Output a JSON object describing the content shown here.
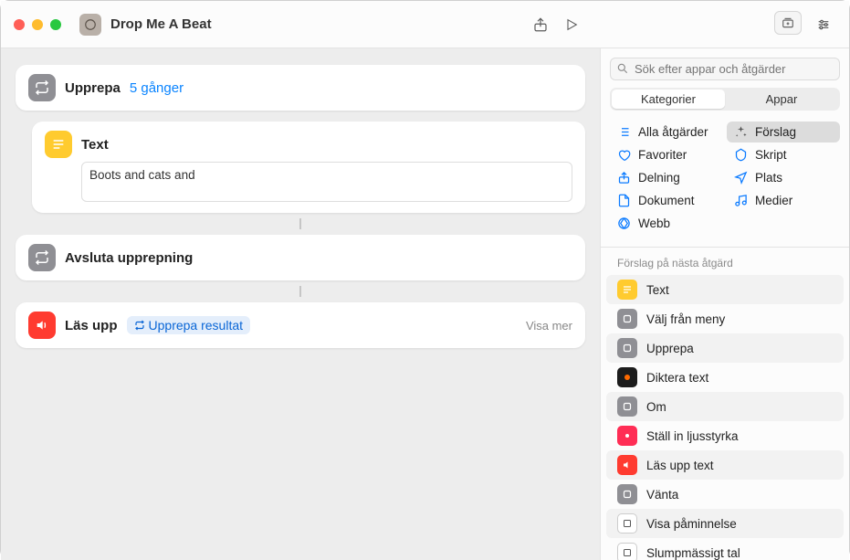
{
  "window": {
    "title": "Drop Me A Beat"
  },
  "canvas": {
    "repeat": {
      "title": "Upprepa",
      "count": "5 gånger"
    },
    "text": {
      "title": "Text",
      "content": "Boots and cats and "
    },
    "endRepeat": {
      "title": "Avsluta upprepning"
    },
    "speak": {
      "title": "Läs upp",
      "varToken": "Upprepa resultat",
      "showMore": "Visa mer"
    }
  },
  "sidebar": {
    "search": {
      "placeholder": "Sök efter appar och åtgärder"
    },
    "seg": {
      "left": "Kategorier",
      "right": "Appar"
    },
    "cats": {
      "all": "Alla åtgärder",
      "suggestions": "Förslag",
      "favorites": "Favoriter",
      "scripting": "Skript",
      "sharing": "Delning",
      "location": "Plats",
      "documents": "Dokument",
      "media": "Medier",
      "web": "Webb"
    },
    "sectionHeader": "Förslag på nästa åtgärd",
    "suggestions": [
      {
        "label": "Text",
        "color": "ic-yellow"
      },
      {
        "label": "Välj från meny",
        "color": "ic-gray"
      },
      {
        "label": "Upprepa",
        "color": "ic-gray"
      },
      {
        "label": "Diktera text",
        "color": "ic-black"
      },
      {
        "label": "Om",
        "color": "ic-gray"
      },
      {
        "label": "Ställ in ljusstyrka",
        "color": "ic-pink"
      },
      {
        "label": "Läs upp text",
        "color": "ic-red"
      },
      {
        "label": "Vänta",
        "color": "ic-gray"
      },
      {
        "label": "Visa påminnelse",
        "color": "ic-white"
      },
      {
        "label": "Slumpmässigt tal",
        "color": "ic-white"
      }
    ]
  }
}
